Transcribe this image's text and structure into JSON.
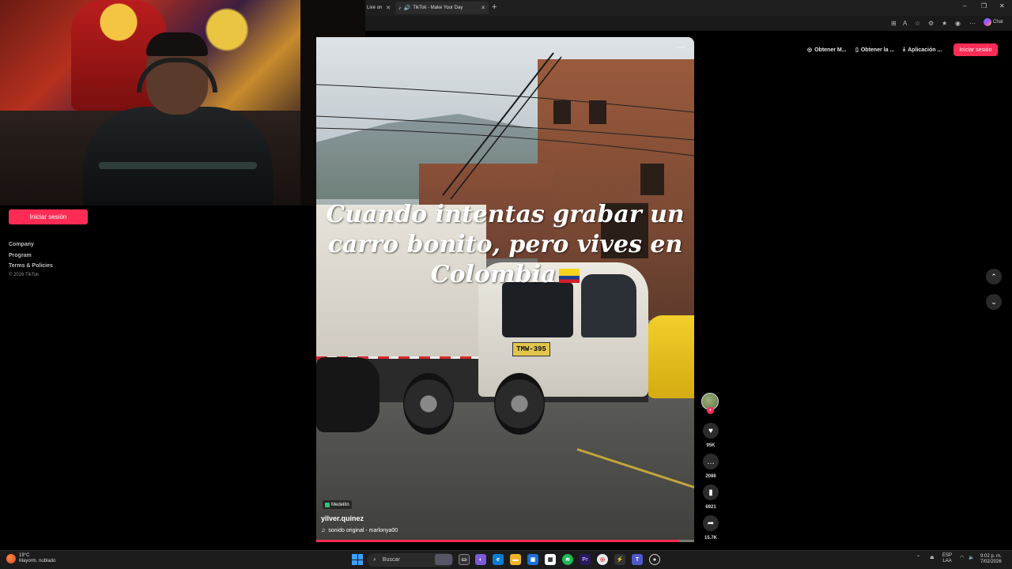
{
  "browser": {
    "tabs": [
      {
        "label": "Live on",
        "active": false
      },
      {
        "label": "TikTok - Make Your Day",
        "active": true
      }
    ],
    "new_tab_icon": "plus-icon",
    "copilot_label": "Chat",
    "toolbar_icons": [
      "apps-icon",
      "reader-icon",
      "favorite-icon",
      "extensions-icon",
      "favorites-icon",
      "profile-icon",
      "more-icon"
    ]
  },
  "header": {
    "links": [
      {
        "label": "Obtener M...",
        "icon": "coin-icon"
      },
      {
        "label": "Obtener la ...",
        "icon": "phone-icon"
      },
      {
        "label": "Aplicación ...",
        "icon": "download-icon"
      }
    ],
    "login": "Iniciar sesión"
  },
  "sidebar": {
    "login": "Iniciar sesión",
    "footer_links": [
      "Company",
      "Program",
      "Terms & Policies"
    ],
    "copyright": "© 2026 TikTok"
  },
  "video": {
    "caption_lines": [
      "Cuando intentas grabar un",
      "carro bonito, pero vives en",
      "Colombia"
    ],
    "plate": "TMW-395",
    "location": "Medellín",
    "username": "yilver.quinez",
    "sound": "sonido original - marlonya00",
    "progress": 0.96
  },
  "actions": {
    "likes": "95K",
    "comments": "2086",
    "saves": "6921",
    "shares": "15.7K"
  },
  "taskbar": {
    "temperature": "19°C",
    "weather": "Mayorm. nublado",
    "search": "Buscar",
    "lang_top": "ESP",
    "lang_bottom": "LAA",
    "time": "9:02 p. m.",
    "date": "7/02/2026"
  },
  "colors": {
    "accent": "#fe2c55",
    "background": "#000000"
  }
}
